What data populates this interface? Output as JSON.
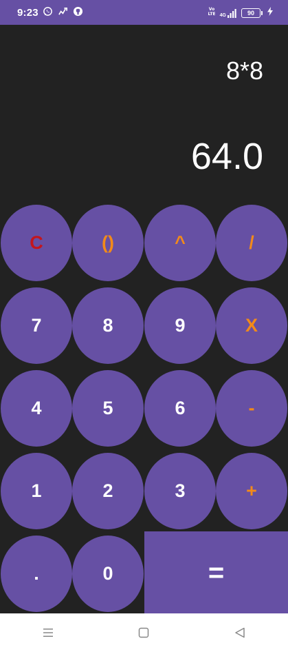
{
  "status_bar": {
    "time": "9:23",
    "left_icons": [
      "whatsapp-icon",
      "signal-data-icon",
      "github-icon"
    ],
    "right_icons": [
      "volte-icon",
      "4g-signal-icon",
      "battery-icon",
      "charging-icon"
    ],
    "network_label": "4G",
    "battery_level": "90",
    "background_color": "#6650a4"
  },
  "display": {
    "expression": "8*8",
    "result": "64.0"
  },
  "keypad": {
    "clear": "C",
    "parentheses": "()",
    "power": "^",
    "divide": "/",
    "seven": "7",
    "eight": "8",
    "nine": "9",
    "multiply": "X",
    "four": "4",
    "five": "5",
    "six": "6",
    "minus": "-",
    "one": "1",
    "two": "2",
    "three": "3",
    "plus": "+",
    "dot": ".",
    "zero": "0",
    "equals": "="
  },
  "colors": {
    "key_background": "#6650a4",
    "app_background": "#222222",
    "operator_text": "#f28a1a",
    "clear_text": "#c4161c",
    "digit_text": "#ffffff"
  },
  "nav_bar": {
    "icons": [
      "menu-icon",
      "home-icon",
      "back-icon"
    ]
  }
}
